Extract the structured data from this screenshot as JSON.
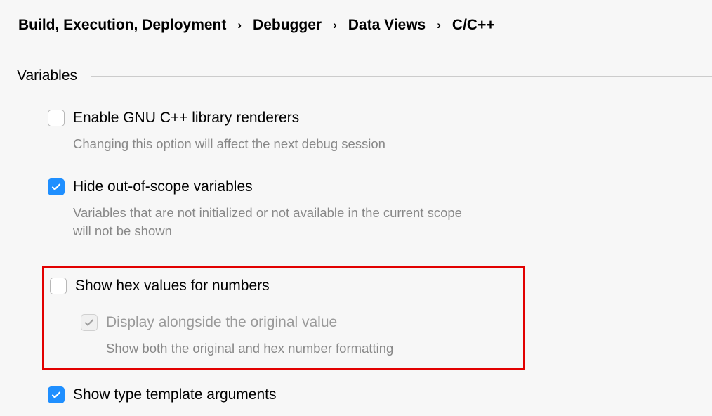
{
  "breadcrumb": {
    "items": [
      "Build, Execution, Deployment",
      "Debugger",
      "Data Views",
      "C/C++"
    ]
  },
  "section": {
    "title": "Variables"
  },
  "options": {
    "enable_gnu": {
      "label": "Enable GNU C++ library renderers",
      "hint": "Changing this option will affect the next debug session",
      "checked": false
    },
    "hide_out_of_scope": {
      "label": "Hide out-of-scope variables",
      "hint": "Variables that are not initialized or not available in the current scope will not be shown",
      "checked": true
    },
    "show_hex": {
      "label": "Show hex values for numbers",
      "checked": false,
      "sub": {
        "label": "Display alongside the original value",
        "hint": "Show both the original and hex number formatting",
        "checked": true,
        "disabled": true
      }
    },
    "show_type_template": {
      "label": "Show type template arguments",
      "checked": true
    }
  }
}
